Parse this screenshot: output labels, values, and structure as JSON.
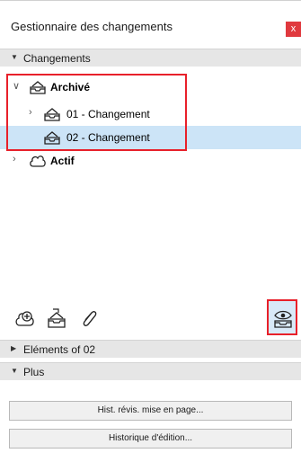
{
  "panel": {
    "title": "Gestionnaire des changements",
    "close_glyph": "x"
  },
  "sections": {
    "changes": {
      "label": "Changements",
      "state": "expanded"
    },
    "elements": {
      "label": "Eléments of 02",
      "state": "collapsed"
    },
    "more": {
      "label": "Plus",
      "state": "expanded"
    }
  },
  "tree": {
    "archived": {
      "label": "Archivé",
      "icon": "archive-tray-icon",
      "expanded": true
    },
    "change01": {
      "label": "01 - Changement",
      "icon": "archive-tray-icon",
      "expanded": false
    },
    "change02": {
      "label": "02 - Changement",
      "icon": "archive-tray-icon",
      "selected": true
    },
    "active": {
      "label": "Actif",
      "icon": "cloud-icon",
      "expanded": false
    }
  },
  "toolbar": {
    "new_change_icon": "add-change-icon",
    "import_icon": "import-tray-icon",
    "attach_icon": "paperclip-icon",
    "toggle_icon": "eye-tray-icon"
  },
  "buttons": {
    "layout_revision_history": "Hist. révis. mise en page...",
    "edit_history": "Historique d'édition..."
  },
  "colors": {
    "highlight": "#e8202a",
    "selection": "#cce4f7",
    "section_bg": "#e6e6e6",
    "close": "#e0393e"
  }
}
